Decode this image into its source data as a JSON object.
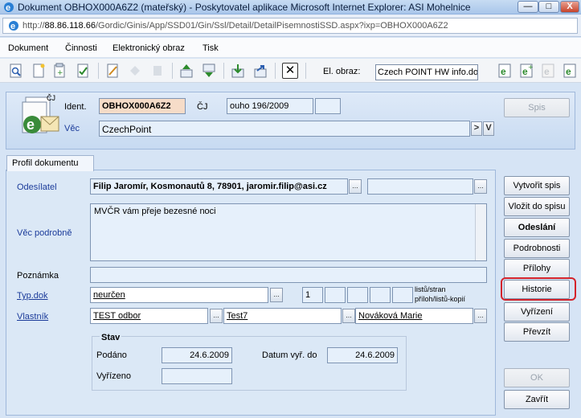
{
  "window": {
    "title": "Dokument OBHOX000A6Z2 (mateřský) - Poskytovatel aplikace Microsoft Internet Explorer: ASI Mohelnice",
    "minimize": "—",
    "maximize": "□",
    "close": "X"
  },
  "address": {
    "prefix": "http://",
    "host": "88.86.118.66",
    "path": "/Gordic/Ginis/App/SSD01/Gin/Ssl/Detail/DetailPisemnostiSSD.aspx?ixp=OBHOX000A6Z2"
  },
  "menu": [
    "Dokument",
    "Činnosti",
    "Elektronický obraz",
    "Tisk"
  ],
  "toolbar": {
    "el_obraz_label": "El. obraz:",
    "el_obraz_value": "Czech POINT HW info.doc",
    "close_glyph": "✕"
  },
  "header": {
    "ident_label": "Ident.",
    "ident_value": "OBHOX000A6Z2",
    "cj_label": "ČJ",
    "cj_value": "ouho 196/2009",
    "vec_label": "Věc",
    "vec_value": "CzechPoint",
    "cj_badge": "ČJ",
    "spis_button": "Spis",
    "arrow_btn": ">",
    "v_btn": "V"
  },
  "tab": {
    "label": "Profil dokumentu"
  },
  "form": {
    "odesilatel_label": "Odesílatel",
    "odesilatel_value": "Filip  Jaromír, Kosmonautů 8, 78901, jaromir.filip@asi.cz",
    "vec_podrobne_label": "Věc podrobně",
    "vec_podrobne_value": "MVČR vám přeje bezesné noci",
    "poznamka_label": "Poznámka",
    "typ_dok_label": "Typ.dok",
    "typ_dok_value": "neurčen",
    "listu_value": "1",
    "listu_label_1": "listů/stran",
    "listu_label_2": "příloh/listů-kopií",
    "vlastnik_label": "Vlastník",
    "vlastnik_odbor": "TEST odbor",
    "vlastnik_misto": "Test7",
    "vlastnik_osoba": "Nováková Marie",
    "dots": "..."
  },
  "stav": {
    "title": "Stav",
    "podano_label": "Podáno",
    "podano_value": "24.6.2009",
    "datum_vyr_label": "Datum vyř. do",
    "datum_vyr_value": "24.6.2009",
    "vyrizeno_label": "Vyřízeno",
    "vyrizeno_value": ""
  },
  "actions": {
    "vytvorit_spis": "Vytvořit spis",
    "vlozit_do_spisu": "Vložit do spisu",
    "odeslani": "Odeslání",
    "podrobnosti": "Podrobnosti",
    "prilohy": "Přílohy",
    "historie": "Historie",
    "vyrizeni": "Vyřízení",
    "prevzit": "Převzít",
    "ok": "OK",
    "zavrit": "Zavřít"
  },
  "colors": {
    "highlight": "#d4232b",
    "ident_bg": "#f6dcc8",
    "field_bg": "#e6f0fb"
  }
}
